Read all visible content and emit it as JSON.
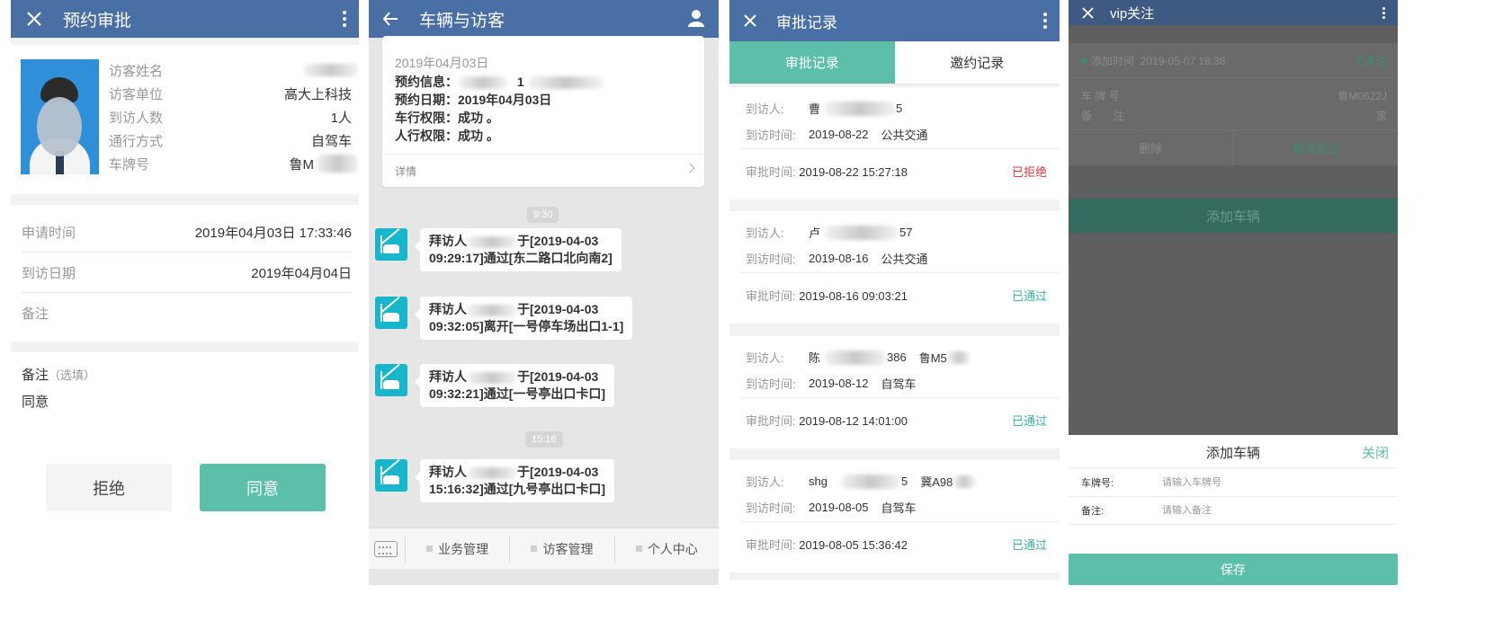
{
  "screen1": {
    "title": "预约审批",
    "visitor": [
      {
        "label": "访客姓名",
        "value": ""
      },
      {
        "label": "访客单位",
        "value": "高大上科技"
      },
      {
        "label": "到访人数",
        "value": "1人"
      },
      {
        "label": "通行方式",
        "value": "自驾车"
      },
      {
        "label": "车牌号",
        "value": "鲁M"
      }
    ],
    "apply_time_label": "申请时间",
    "apply_time": "2019年04月03日 17:33:46",
    "visit_date_label": "到访日期",
    "visit_date": "2019年04月04日",
    "remark_label": "备注",
    "note_label": "备注",
    "note_optional": "（选填）",
    "note_value": "同意",
    "reject": "拒绝",
    "approve": "同意"
  },
  "screen2": {
    "title": "车辆与访客",
    "card": {
      "date": "2019年04月03日",
      "info_label": "预约信息：",
      "info_value": "1",
      "date_label": "预约日期：",
      "date_value": "2019年04月03日",
      "car_label": "车行权限：",
      "car_value": "成功 。",
      "walk_label": "人行权限：",
      "walk_value": "成功 。",
      "detail": "详情"
    },
    "time1": "9:30",
    "time2": "15:16",
    "messages": [
      {
        "prefix": "拜访人",
        "l1": "于[2019-04-03",
        "l2": "09:29:17]通过[东二路口北向南2]"
      },
      {
        "prefix": "拜访人",
        "l1": "于[2019-04-03",
        "l2": "09:32:05]离开[一号停车场出口1-1]"
      },
      {
        "prefix": "拜访人",
        "l1": "于[2019-04-03",
        "l2": "09:32:21]通过[一号亭出口卡口]"
      },
      {
        "prefix": "拜访人",
        "l1": "于[2019-04-03",
        "l2": "15:16:32]通过[九号亭出口卡口]"
      }
    ],
    "tabs": [
      "业务管理",
      "访客管理",
      "个人中心"
    ]
  },
  "screen3": {
    "title": "审批记录",
    "tab_active": "审批记录",
    "tab_other": "邀约记录",
    "visitor_label": "到访人:",
    "time_label": "到访时间:",
    "approve_label": "审批时间:",
    "records": [
      {
        "visitor": "曹",
        "tail": "5",
        "extra": "",
        "visit_time": "2019-08-22",
        "mode": "公共交通",
        "approve_time": "2019-08-22 15:27:18",
        "status": "已拒绝",
        "status_color": "#e0393e"
      },
      {
        "visitor": "卢",
        "tail": "57",
        "extra": "",
        "visit_time": "2019-08-16",
        "mode": "公共交通",
        "approve_time": "2019-08-16 09:03:21",
        "status": "已通过",
        "status_color": "#3db39e"
      },
      {
        "visitor": "陈",
        "tail": "386",
        "extra": "鲁M5",
        "visit_time": "2019-08-12",
        "mode": "自驾车",
        "approve_time": "2019-08-12 14:01:00",
        "status": "已通过",
        "status_color": "#3db39e"
      },
      {
        "visitor": "shg",
        "tail": "5",
        "extra": "冀A98",
        "visit_time": "2019-08-05",
        "mode": "自驾车",
        "approve_time": "2019-08-05 15:36:42",
        "status": "已通过",
        "status_color": "#3db39e"
      }
    ]
  },
  "screen4": {
    "title": "vip关注",
    "add_time_label": "添加时间",
    "add_time": "2019-05-07 18:38",
    "followed": "已关注",
    "plate_label": "车 牌 号",
    "plate": "鲁M0622J",
    "note_label": "备　　注",
    "note": "家",
    "delete": "删除",
    "unfollow": "取消关注",
    "add_vehicle": "添加车辆",
    "sheet_title": "添加车辆",
    "close": "关闭",
    "plate_field_label": "车牌号:",
    "plate_placeholder": "请输入车牌号",
    "remark_field_label": "备注:",
    "remark_placeholder": "请输入备注",
    "save": "保存"
  },
  "colors": {
    "header": "#4a6fa5",
    "accent": "#5bbfaa",
    "reject": "#e0393e"
  }
}
